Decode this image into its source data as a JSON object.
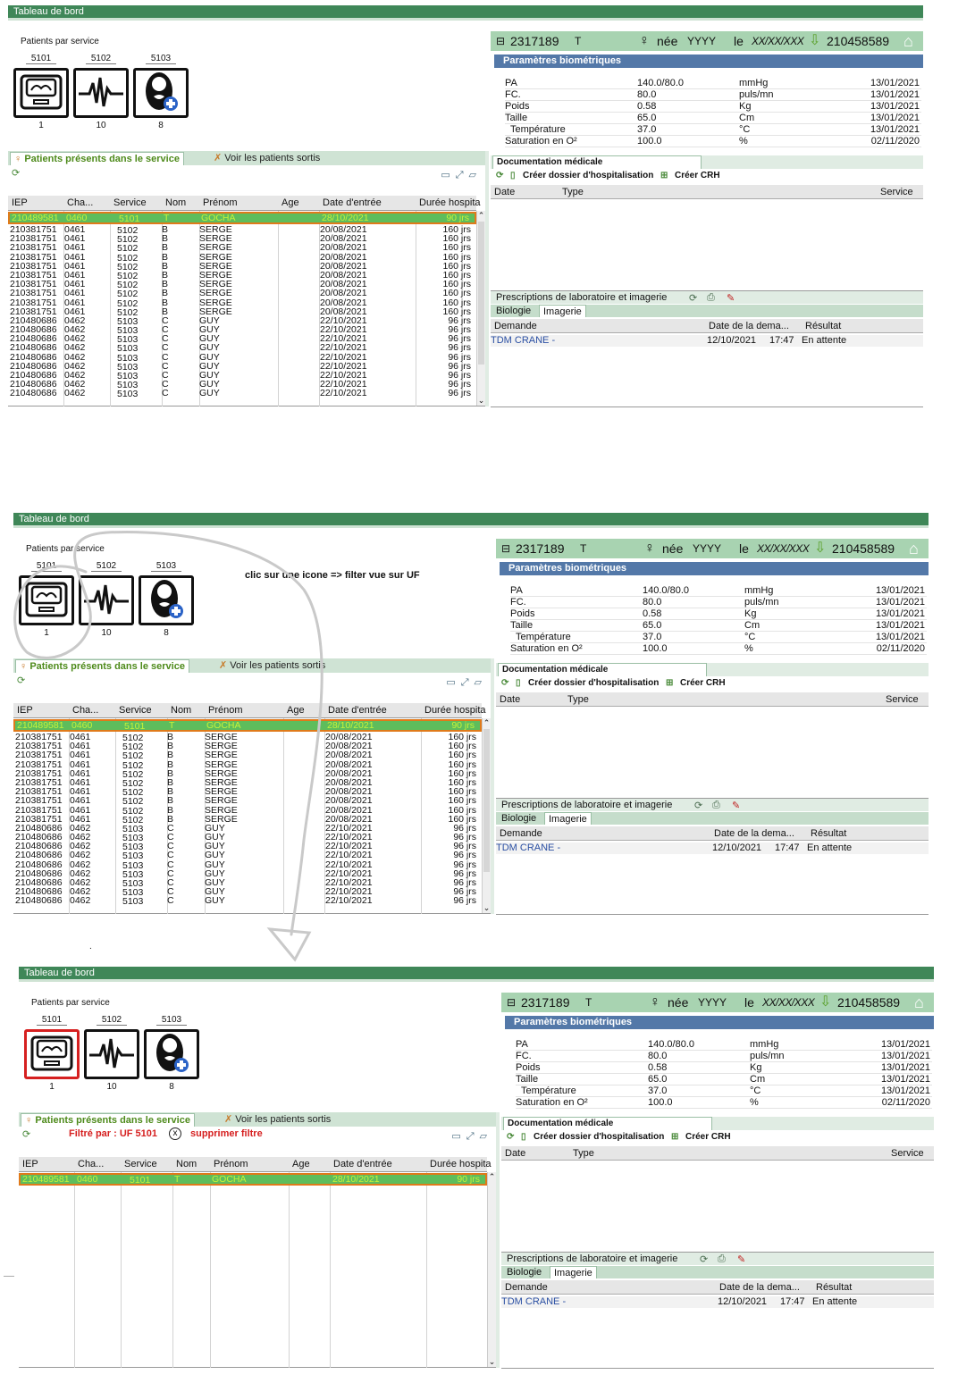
{
  "app": {
    "title": "Tableau de bord"
  },
  "services": {
    "label": "Patients par service",
    "items": [
      {
        "code": "5101",
        "count": "1",
        "icon": "incubator-icon"
      },
      {
        "code": "5102",
        "count": "10",
        "icon": "heartbeat-icon"
      },
      {
        "code": "5103",
        "count": "8",
        "icon": "newborn-icon"
      }
    ]
  },
  "tabs": {
    "present": "Patients présents dans le service",
    "exited": "Voir les patients sortis"
  },
  "filter": {
    "text": "Filtré par : UF 5101",
    "remove": "supprimer filtre",
    "x": "x"
  },
  "annotation": "clic sur une icone => filter vue sur UF",
  "grid": {
    "columns": [
      "IEP",
      "Cha...",
      "Service",
      "Nom",
      "Prénom",
      "Age",
      "Date d'entrée",
      "Durée hospita"
    ],
    "rows": [
      [
        "210489581",
        "0460",
        "5101",
        "T",
        "GOCHA",
        "",
        "28/10/2021",
        "90 jrs"
      ],
      [
        "210381751",
        "0461",
        "5102",
        "B",
        "SERGE",
        "",
        "20/08/2021",
        "160 jrs"
      ],
      [
        "210381751",
        "0461",
        "5102",
        "B",
        "SERGE",
        "",
        "20/08/2021",
        "160 jrs"
      ],
      [
        "210381751",
        "0461",
        "5102",
        "B",
        "SERGE",
        "",
        "20/08/2021",
        "160 jrs"
      ],
      [
        "210381751",
        "0461",
        "5102",
        "B",
        "SERGE",
        "",
        "20/08/2021",
        "160 jrs"
      ],
      [
        "210381751",
        "0461",
        "5102",
        "B",
        "SERGE",
        "",
        "20/08/2021",
        "160 jrs"
      ],
      [
        "210381751",
        "0461",
        "5102",
        "B",
        "SERGE",
        "",
        "20/08/2021",
        "160 jrs"
      ],
      [
        "210381751",
        "0461",
        "5102",
        "B",
        "SERGE",
        "",
        "20/08/2021",
        "160 jrs"
      ],
      [
        "210381751",
        "0461",
        "5102",
        "B",
        "SERGE",
        "",
        "20/08/2021",
        "160 jrs"
      ],
      [
        "210381751",
        "0461",
        "5102",
        "B",
        "SERGE",
        "",
        "20/08/2021",
        "160 jrs"
      ],
      [
        "210381751",
        "0461",
        "5102",
        "B",
        "SERGE",
        "",
        "20/08/2021",
        "160 jrs"
      ],
      [
        "210480686",
        "0462",
        "5103",
        "C",
        "GUY",
        "",
        "22/10/2021",
        "96 jrs"
      ],
      [
        "210480686",
        "0462",
        "5103",
        "C",
        "GUY",
        "",
        "22/10/2021",
        "96 jrs"
      ],
      [
        "210480686",
        "0462",
        "5103",
        "C",
        "GUY",
        "",
        "22/10/2021",
        "96 jrs"
      ],
      [
        "210480686",
        "0462",
        "5103",
        "C",
        "GUY",
        "",
        "22/10/2021",
        "96 jrs"
      ],
      [
        "210480686",
        "0462",
        "5103",
        "C",
        "GUY",
        "",
        "22/10/2021",
        "96 jrs"
      ],
      [
        "210480686",
        "0462",
        "5103",
        "C",
        "GUY",
        "",
        "22/10/2021",
        "96 jrs"
      ],
      [
        "210480686",
        "0462",
        "5103",
        "C",
        "GUY",
        "",
        "22/10/2021",
        "96 jrs"
      ],
      [
        "210480686",
        "0462",
        "5103",
        "C",
        "GUY",
        "",
        "22/10/2021",
        "96 jrs"
      ],
      [
        "210480686",
        "0462",
        "5103",
        "C",
        "GUY",
        "",
        "22/10/2021",
        "96 jrs"
      ]
    ]
  },
  "patient": {
    "collapse": "⊟",
    "iep": "2317189",
    "letter": "T",
    "born_label": "née",
    "born_value": "YYYY",
    "le_label": "le",
    "date": "XX/XX/XXX",
    "number": "210458589"
  },
  "bio": {
    "title": "Paramètres biométriques",
    "rows": [
      [
        "PA",
        "140.0/80.0",
        "mmHg",
        "13/01/2021"
      ],
      [
        "FC.",
        "80.0",
        "puls/mn",
        "13/01/2021"
      ],
      [
        "Poids",
        "0.58",
        "Kg",
        "13/01/2021"
      ],
      [
        "Taille",
        "65.0",
        "Cm",
        "13/01/2021"
      ],
      [
        "Température",
        "37.0",
        "°C",
        "13/01/2021"
      ],
      [
        "Saturation en O²",
        "100.0",
        "%",
        "02/11/2020"
      ]
    ]
  },
  "doc": {
    "title": "Documentation médicale",
    "create_hosp": "Créer dossier d'hospitalisation",
    "create_crh": "Créer CRH",
    "columns": [
      "Date",
      "Type",
      "Service"
    ]
  },
  "presc": {
    "title": "Prescriptions de laboratoire et imagerie",
    "subtabs": [
      "Biologie",
      "Imagerie"
    ],
    "columns": [
      "Demande",
      "Date de la dema...",
      "Résultat"
    ],
    "row": {
      "demande": "TDM CRANE -",
      "date": "12/10/2021",
      "time": "17:47",
      "result": "En attente"
    }
  },
  "misc": {
    "dot": "."
  }
}
